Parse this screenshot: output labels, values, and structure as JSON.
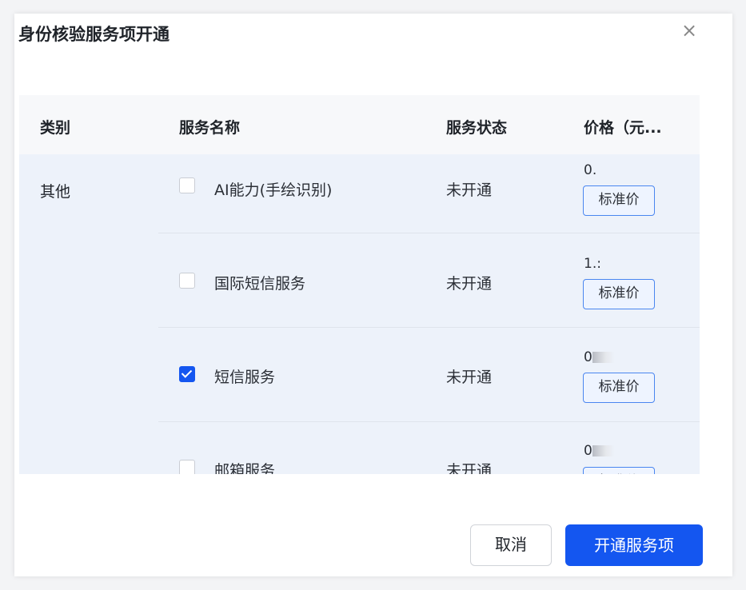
{
  "dialog": {
    "title": "身份核验服务项开通",
    "close_glyph": "×"
  },
  "table": {
    "headers": {
      "category": "类别",
      "service_name": "服务名称",
      "service_status": "服务状态",
      "price": "价格（元..."
    },
    "category": "其他",
    "rows": [
      {
        "name": "AI能力(手绘识别)",
        "status": "未开通",
        "price": "0.",
        "price_masked": false,
        "tag": "标准价",
        "checked": false
      },
      {
        "name": "国际短信服务",
        "status": "未开通",
        "price": "1.:",
        "price_masked": false,
        "tag": "标准价",
        "checked": false
      },
      {
        "name": "短信服务",
        "status": "未开通",
        "price": "0",
        "price_masked": true,
        "tag": "标准价",
        "checked": true
      },
      {
        "name": "邮箱服务",
        "status": "未开通",
        "price": "0",
        "price_masked": true,
        "tag": "标准价",
        "checked": false
      }
    ]
  },
  "footer": {
    "cancel_label": "取消",
    "confirm_label": "开通服务项"
  },
  "colors": {
    "primary": "#1456f0",
    "row_bg": "#edf2fa",
    "header_bg": "#f7f8fa",
    "tag_border": "#4a86f0"
  }
}
